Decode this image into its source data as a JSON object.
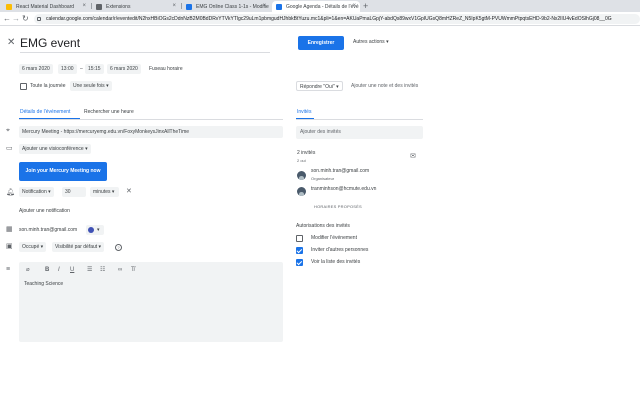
{
  "browser": {
    "tabs": [
      {
        "title": "React Material Dashboard",
        "favicon_color": "#fbbc04"
      },
      {
        "title": "Extensions",
        "favicon_color": "#5f6368"
      },
      {
        "title": "EMG Online Class 1-1s - Modifie",
        "favicon_color": "#1a73e8"
      },
      {
        "title": "Google Agenda - Détails de l'évé",
        "favicon_color": "#1a73e8"
      }
    ],
    "new_tab": "+",
    "url": "calendar.google.com/calendar/r/eventedit/N2hxHBiOGs2cDdnNzB2M0BdDRvYTVkYTlgc29uLm1pbmgudHJhbkBtYuzu.mc1&pli=1&en=AKUaPmaLGpjY-abdQs89wxV1GpIUGsQ8mHZReZ_N5IpK5gtM-PVUWmmPtpqtsEHD-9b2-Nx2lIU4vEdOSlhGj08__0G"
  },
  "event": {
    "close_icon": "close-icon",
    "title": "EMG event",
    "save_label": "Enregistrer",
    "more_actions_label": "Autres actions",
    "start_date": "6 mars 2020",
    "start_time": "13:00",
    "dash": "–",
    "end_time": "15:15",
    "end_date": "6 mars 2020",
    "timezone_label": "Fuseau horaire",
    "all_day_label": "Toute la journée",
    "repeat_label": "Une seule fois",
    "rsvp_label": "Répondre \"Oui\"",
    "add_note_label": "Ajouter une note et des invités"
  },
  "details": {
    "tab_details": "Détails de l'événement",
    "tab_find_time": "Rechercher une heure",
    "location": "Mercury Meeting - https://mercuryemg.edu.vn/FoxyMonkeysJinxAllTheTime",
    "add_conference": "Ajouter une visioconférence",
    "join_meeting": "Join your Mercury Meeting now",
    "notification_type": "Notification",
    "notification_value": "30",
    "notification_unit": "minutes",
    "add_notification": "Ajouter une notification",
    "calendar_owner": "son.minh.tran@gmail.com",
    "busy_label": "Occupé",
    "visibility_label": "Visibilité par défaut",
    "help_glyph": "?",
    "description": "Teaching Science",
    "toolbar_icons": [
      "attachment-icon",
      "bold-icon",
      "italic-icon",
      "underline-icon",
      "numbered-list-icon",
      "bulleted-list-icon",
      "link-icon",
      "clear-format-icon"
    ]
  },
  "guests": {
    "tab_label": "Invités",
    "add_placeholder": "Ajouter des invités",
    "count_label": "2 invités",
    "status_label": "2 oui",
    "list": [
      {
        "email": "son.minh.tran@gmail.com",
        "role": "Organisateur"
      },
      {
        "email": "tranminhson@hcmute.edu.vn",
        "role": ""
      }
    ],
    "proposed_times": "HORAIRES PROPOSÉS",
    "permissions_title": "Autorisations des invités",
    "permissions": [
      {
        "label": "Modifier l'événement",
        "checked": false
      },
      {
        "label": "Inviter d'autres personnes",
        "checked": true
      },
      {
        "label": "Voir la liste des invités",
        "checked": true
      }
    ]
  },
  "colors": {
    "accent": "#1a73e8",
    "event_color": "#3f51b5"
  }
}
